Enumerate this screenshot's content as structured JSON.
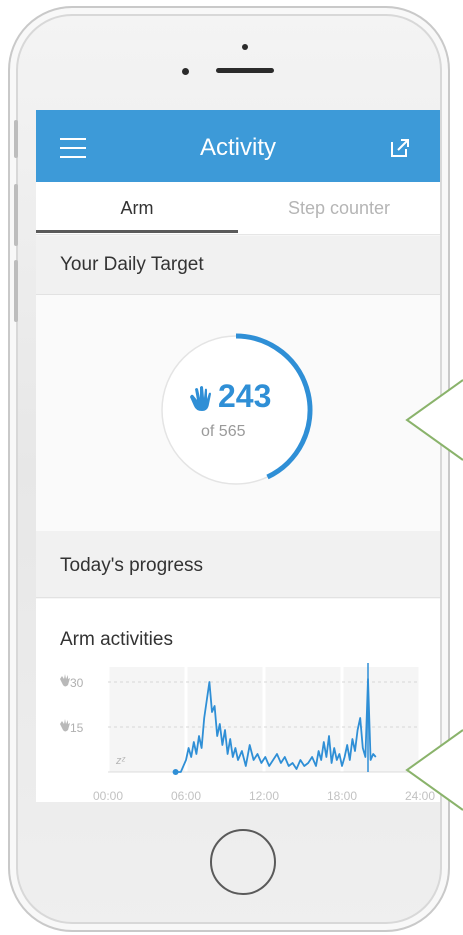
{
  "app": {
    "title": "Activity",
    "colors": {
      "accent": "#3d9ad8",
      "ring": "#2f8fd6",
      "series": "#2f8fd6"
    }
  },
  "topbar": {
    "menu_icon": "hamburger-menu-icon",
    "share_icon": "share-external-icon"
  },
  "tabs": [
    {
      "label": "Arm",
      "active": true
    },
    {
      "label": "Step counter",
      "active": false
    }
  ],
  "daily_target": {
    "header": "Your Daily Target",
    "value": "243",
    "of_label": "of 565",
    "current": 243,
    "target": 565,
    "icon": "hand-wave-icon"
  },
  "progress": {
    "header": "Today's progress"
  },
  "arm_activities": {
    "title": "Arm activities",
    "sleep_icon": "sleep-zz-icon"
  },
  "chart_data": {
    "type": "line",
    "title": "Arm activities",
    "y_ticks": [
      30,
      15
    ],
    "x_ticks": [
      "00:00",
      "06:00",
      "12:00",
      "18:00",
      "24:00"
    ],
    "ylim": [
      0,
      35
    ],
    "xlim": [
      0,
      24
    ],
    "series": [
      {
        "x": [
          5.2,
          5.6,
          6.0,
          6.2,
          6.4,
          6.6,
          6.8,
          7.0,
          7.2,
          7.4,
          7.6,
          7.8,
          8.0,
          8.2,
          8.4,
          8.6,
          8.8,
          9.0,
          9.2,
          9.4,
          9.6,
          9.8,
          10.0,
          10.3,
          10.6,
          10.9,
          11.2,
          11.5,
          11.8,
          12.1,
          12.4,
          12.7,
          13.0,
          13.3,
          13.6,
          13.9,
          14.2,
          14.5,
          14.8,
          15.1,
          15.4,
          15.7,
          16.0,
          16.2,
          16.4,
          16.6,
          16.8,
          17.0,
          17.2,
          17.4,
          17.6,
          17.8,
          18.0,
          18.2,
          18.4,
          18.6,
          18.8,
          19.0,
          19.2,
          19.4,
          19.6,
          19.8,
          20.0,
          20.2,
          20.4,
          20.6
        ],
        "y": [
          0,
          0,
          4,
          8,
          5,
          10,
          6,
          12,
          8,
          18,
          24,
          30,
          20,
          22,
          12,
          16,
          9,
          14,
          6,
          11,
          5,
          8,
          4,
          7,
          2,
          9,
          4,
          6,
          3,
          5,
          2,
          4,
          6,
          3,
          5,
          2,
          3,
          1,
          4,
          2,
          3,
          5,
          2,
          7,
          4,
          10,
          5,
          12,
          3,
          8,
          4,
          6,
          2,
          5,
          9,
          4,
          11,
          7,
          14,
          18,
          8,
          5,
          31,
          4,
          6,
          5
        ]
      }
    ],
    "marker_x": 20.0,
    "grid": true
  }
}
